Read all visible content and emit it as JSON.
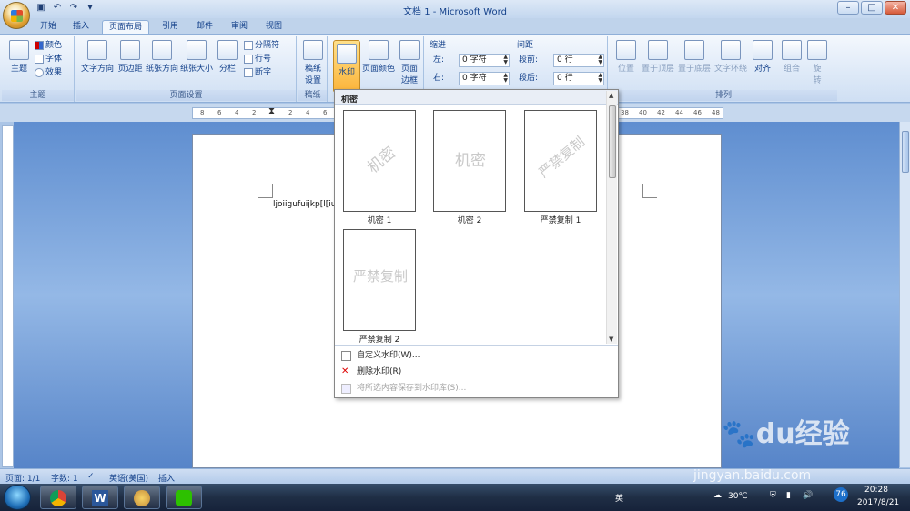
{
  "titlebar": {
    "title": "文档 1 - Microsoft Word"
  },
  "tabs": [
    {
      "label": "开始"
    },
    {
      "label": "插入"
    },
    {
      "label": "页面布局",
      "active": true
    },
    {
      "label": "引用"
    },
    {
      "label": "邮件"
    },
    {
      "label": "审阅"
    },
    {
      "label": "视图"
    }
  ],
  "ribbon": {
    "theme_group": {
      "label": "主题",
      "themes": "主题",
      "colors": "颜色",
      "fonts": "字体",
      "effects": "效果"
    },
    "page_setup": {
      "label": "页面设置",
      "text_direction": "文字方向",
      "margins": "页边距",
      "orientation": "纸张方向",
      "size": "纸张大小",
      "columns": "分栏",
      "breaks": "分隔符",
      "line_numbers": "行号",
      "hyphenation": "断字"
    },
    "draft": {
      "label": "稿纸",
      "button": "稿纸\n设置"
    },
    "background": {
      "watermark": "水印",
      "page_color": "页面颜色",
      "page_border": "页面\n边框"
    },
    "paragraph": {
      "indent_label": "缩进",
      "indent_left_label": "左:",
      "indent_left_value": "0 字符",
      "indent_right_label": "右:",
      "indent_right_value": "0 字符",
      "spacing_label": "间距",
      "spacing_before_label": "段前:",
      "spacing_before_value": "0 行",
      "spacing_after_label": "段后:",
      "spacing_after_value": "0 行"
    },
    "arrange": {
      "label": "排列",
      "position": "位置",
      "bring_front": "置于顶层",
      "send_back": "置于底层",
      "wrap": "文字环绕",
      "align": "对齐",
      "group": "组合",
      "rotate": "旋\n转"
    }
  },
  "ruler": {
    "ticks_left": [
      "8",
      "6",
      "4",
      "2",
      "",
      "2",
      "4",
      "6"
    ],
    "ticks_right": [
      "38",
      "40",
      "42",
      "44",
      "46",
      "48"
    ]
  },
  "document": {
    "text": "ljoiigufuijkp[l[iuij"
  },
  "watermark_dropdown": {
    "header": "机密",
    "items": [
      {
        "label": "机密 1",
        "preview": "机密"
      },
      {
        "label": "机密 2",
        "preview": "机密"
      },
      {
        "label": "严禁复制 1",
        "preview": "严禁复制"
      },
      {
        "label": "严禁复制 2",
        "preview": "严禁复制"
      }
    ],
    "menu": [
      {
        "label": "自定义水印(W)..."
      },
      {
        "label": "删除水印(R)"
      },
      {
        "label": "将所选内容保存到水印库(S)...",
        "disabled": true
      }
    ]
  },
  "statusbar": {
    "page": "页面: 1/1",
    "words": "字数: 1",
    "language": "英语(美国)",
    "mode": "插入"
  },
  "taskbar": {
    "weather": "30℃",
    "time": "20:28",
    "date": "2017/8/21",
    "lang": "英",
    "badge": "76"
  },
  "brand": {
    "watermark": "Baidu经验",
    "url": "jingyan.baidu.com"
  }
}
